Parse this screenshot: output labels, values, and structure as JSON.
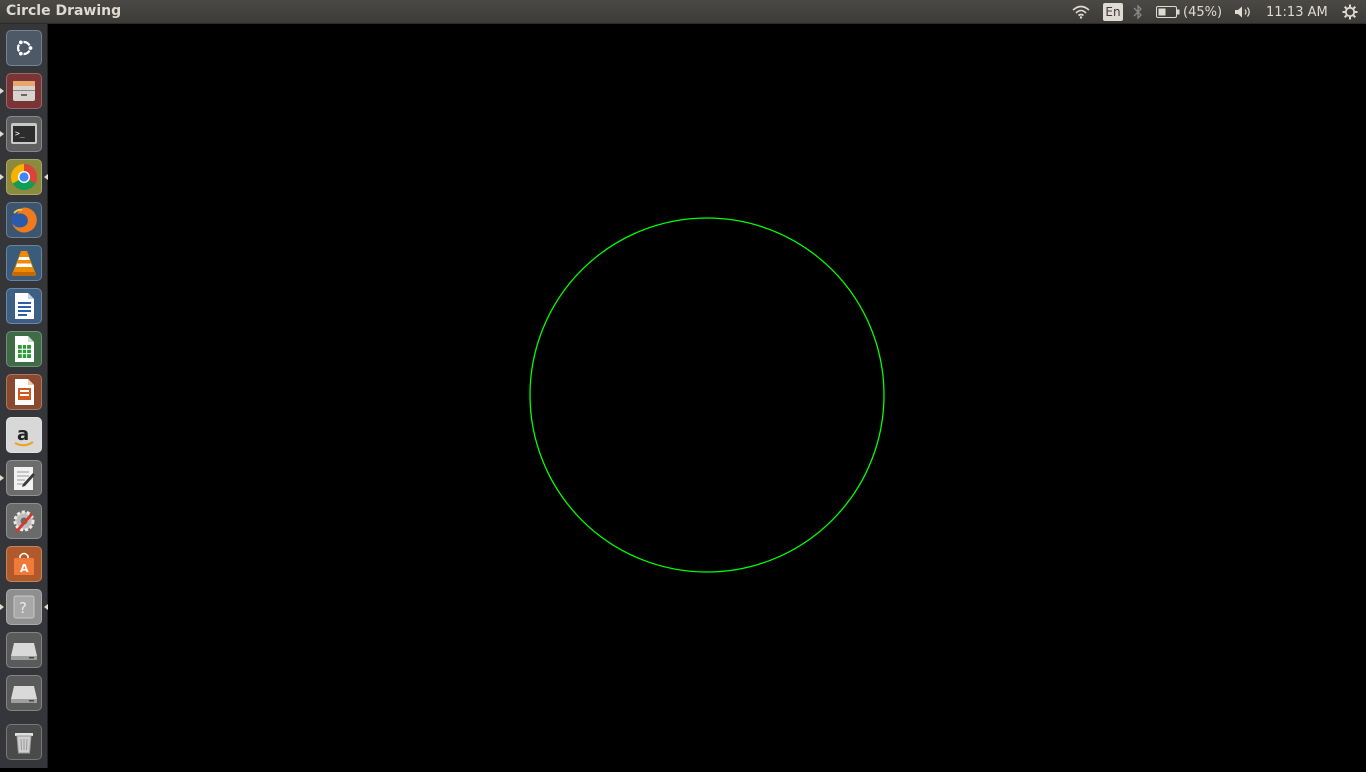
{
  "window": {
    "title": "Circle Drawing"
  },
  "panel": {
    "keyboard_layout": "En",
    "battery_text": "(45%)",
    "clock": "11:13 AM"
  },
  "launcher": {
    "items": [
      {
        "name": "dash-home",
        "icon": "ubuntu-logo-icon"
      },
      {
        "name": "files",
        "icon": "file-cabinet-icon",
        "running": true
      },
      {
        "name": "terminal",
        "icon": "terminal-icon",
        "running": true
      },
      {
        "name": "chrome",
        "icon": "chrome-icon",
        "running": true,
        "focused": true
      },
      {
        "name": "firefox",
        "icon": "firefox-icon"
      },
      {
        "name": "vlc",
        "icon": "vlc-cone-icon"
      },
      {
        "name": "writer",
        "icon": "writer-document-icon"
      },
      {
        "name": "calc",
        "icon": "calc-spreadsheet-icon"
      },
      {
        "name": "impress",
        "icon": "impress-presentation-icon"
      },
      {
        "name": "amazon",
        "icon": "amazon-icon"
      },
      {
        "name": "text-editor",
        "icon": "text-editor-icon",
        "running": true
      },
      {
        "name": "system-settings",
        "icon": "settings-tools-icon"
      },
      {
        "name": "software-center",
        "icon": "software-center-bag-icon"
      },
      {
        "name": "unknown-app",
        "icon": "question-mark-icon",
        "running": true,
        "focused": true
      },
      {
        "name": "drive-1",
        "icon": "hard-drive-icon"
      },
      {
        "name": "drive-2",
        "icon": "hard-drive-icon"
      },
      {
        "name": "trash",
        "icon": "trash-icon"
      }
    ]
  },
  "drawing": {
    "stroke_color": "#00ff00",
    "background_color": "#000000"
  }
}
